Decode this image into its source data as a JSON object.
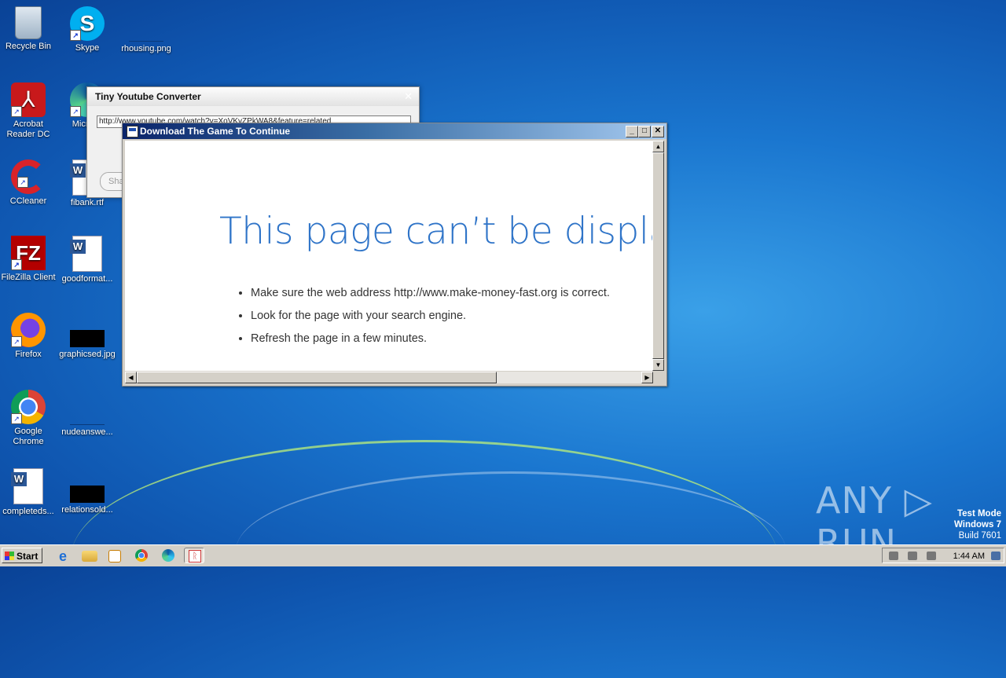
{
  "desktop": {
    "icons": [
      {
        "label": "Recycle Bin",
        "icon": "recycle-bin-icon"
      },
      {
        "label": "Skype",
        "icon": "skype-icon"
      },
      {
        "label": "rhousing.png",
        "icon": "image-file-icon"
      },
      {
        "label": "Acrobat Reader DC",
        "icon": "acrobat-icon"
      },
      {
        "label": "Microso",
        "icon": "edge-icon"
      },
      {
        "label": "CCleaner",
        "icon": "ccleaner-icon"
      },
      {
        "label": "fibank.rtf",
        "icon": "word-doc-icon"
      },
      {
        "label": "FileZilla Client",
        "icon": "filezilla-icon"
      },
      {
        "label": "goodformat...",
        "icon": "word-doc-icon"
      },
      {
        "label": "Firefox",
        "icon": "firefox-icon"
      },
      {
        "label": "graphicsed.jpg",
        "icon": "image-file-icon"
      },
      {
        "label": "Google Chrome",
        "icon": "chrome-icon"
      },
      {
        "label": "nudeanswe...",
        "icon": "image-file-icon"
      },
      {
        "label": "completeds...",
        "icon": "word-doc-icon"
      },
      {
        "label": "relationsold...",
        "icon": "image-file-icon"
      }
    ]
  },
  "bg_window": {
    "title": "Tiny Youtube Converter",
    "url": "http://www.youtube.com/watch?v=XoVKvZPkWA8&feature=related",
    "button_label": "Sha"
  },
  "dialog": {
    "title": "Download The Game To Continue",
    "heading": "This page can’t be display",
    "bullets": [
      "Make sure the web address http://www.make-money-fast.org is correct.",
      "Look for the page with your search engine.",
      "Refresh the page in a few minutes."
    ]
  },
  "taskbar": {
    "start_label": "Start",
    "clock": "1:44 AM",
    "pinned": [
      "ie-icon",
      "explorer-icon",
      "media-player-icon",
      "chrome-icon",
      "edge-icon",
      "rss-app-icon"
    ]
  },
  "watermark": {
    "line1": "Test Mode",
    "line2": "Windows 7",
    "line3": "Build 7601",
    "brand": "ANY ▷ RUN"
  }
}
